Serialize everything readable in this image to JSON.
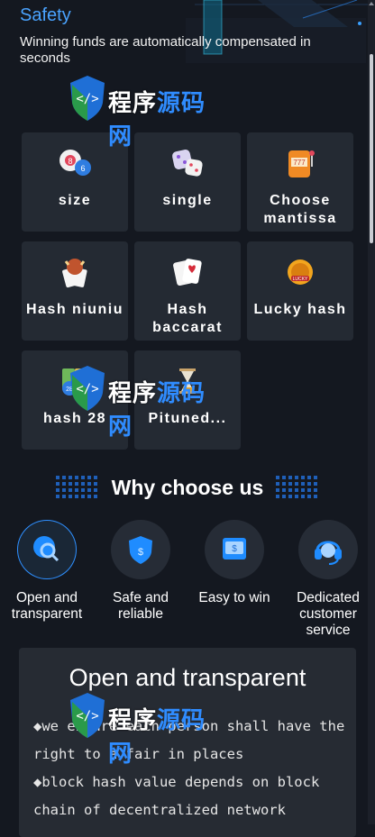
{
  "safety": {
    "title": "Safety",
    "description": "Winning funds are automatically compensated in seconds"
  },
  "games": [
    {
      "name": "size",
      "icon": "billiard-balls-icon"
    },
    {
      "name": "single",
      "icon": "dice-icon"
    },
    {
      "name": "Choose mantissa",
      "icon": "slot-machine-icon"
    },
    {
      "name": "Hash niuniu",
      "icon": "bull-cards-icon"
    },
    {
      "name": "Hash baccarat",
      "icon": "poker-cards-icon"
    },
    {
      "name": "Lucky hash",
      "icon": "lucky-coin-icon"
    },
    {
      "name": "hash 28",
      "icon": "lottery-balls-icon"
    },
    {
      "name": "Pituned...",
      "icon": "hourglass-icon"
    }
  ],
  "why": {
    "title": "Why choose us",
    "features": [
      {
        "label": "Open and transparent",
        "icon": "magnifier-icon",
        "active": true
      },
      {
        "label": "Safe and reliable",
        "icon": "shield-icon",
        "active": false
      },
      {
        "label": "Easy to win",
        "icon": "wallet-icon",
        "active": false
      },
      {
        "label": "Dedicated customer service",
        "icon": "headset-icon",
        "active": false
      }
    ]
  },
  "info_card": {
    "title": "Open and transparent",
    "lines": [
      "◆we ensure each person shall have the",
      "right to a fair in places",
      "◆block hash value depends on block",
      "chain of decentralized network"
    ]
  },
  "watermark": {
    "part1": "程序",
    "part2": "源码网"
  },
  "colors": {
    "background": "#141820",
    "card": "#242a33",
    "accent": "#4aa3ff"
  }
}
